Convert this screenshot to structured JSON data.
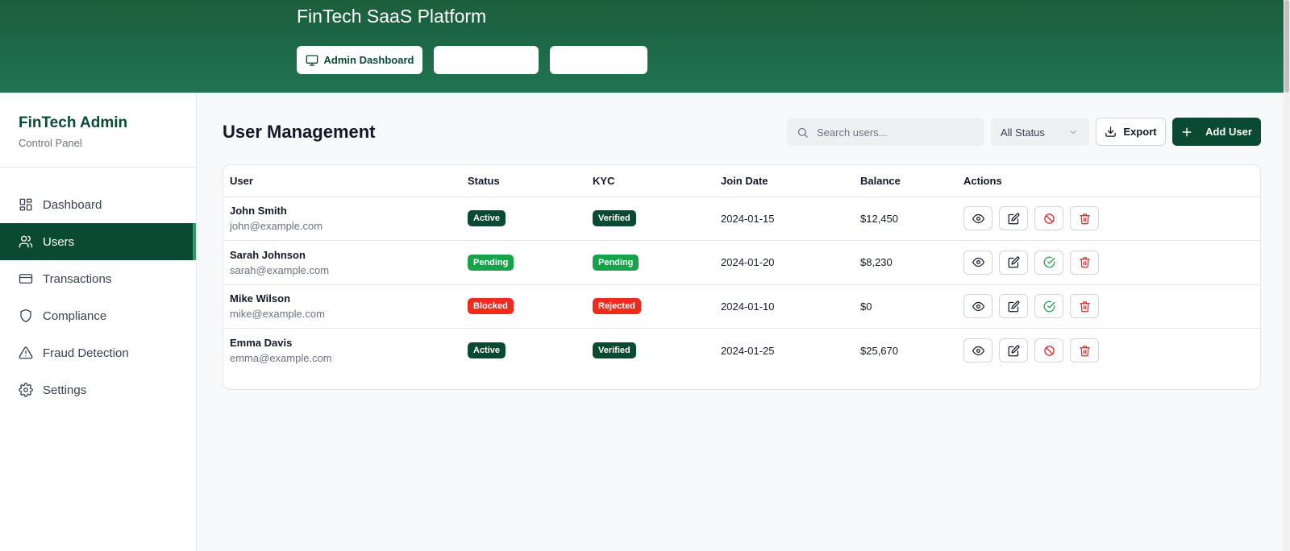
{
  "colors": {
    "brand_dark": "#0b4a32",
    "banner": "#1b5e3b",
    "badge_active": "#0b4a32",
    "badge_pending": "#16a34a",
    "badge_blocked": "#ef2b1e",
    "icon_danger": "#dc2626",
    "icon_success": "#16a34a"
  },
  "banner": {
    "title": "FinTech SaaS Platform",
    "tabs": [
      {
        "label": "Admin Dashboard",
        "icon": "monitor-icon"
      },
      {
        "label": ""
      },
      {
        "label": ""
      }
    ]
  },
  "sidebar": {
    "title": "FinTech Admin",
    "subtitle": "Control Panel",
    "items": [
      {
        "label": "Dashboard",
        "icon": "dashboard-icon",
        "active": false
      },
      {
        "label": "Users",
        "icon": "users-icon",
        "active": true
      },
      {
        "label": "Transactions",
        "icon": "credit-card-icon",
        "active": false
      },
      {
        "label": "Compliance",
        "icon": "shield-icon",
        "active": false
      },
      {
        "label": "Fraud Detection",
        "icon": "warning-icon",
        "active": false
      },
      {
        "label": "Settings",
        "icon": "gear-icon",
        "active": false
      }
    ]
  },
  "main": {
    "title": "User Management",
    "search": {
      "placeholder": "Search users...",
      "value": ""
    },
    "status_filter": {
      "selected": "All Status"
    },
    "export_label": "Export",
    "add_label": "Add User",
    "table": {
      "columns": [
        "User",
        "Status",
        "KYC",
        "Join Date",
        "Balance",
        "Actions"
      ],
      "rows": [
        {
          "name": "John Smith",
          "email": "john@example.com",
          "status": "Active",
          "kyc": "Verified",
          "join_date": "2024-01-15",
          "balance": "$12,450",
          "toggle_action": "block"
        },
        {
          "name": "Sarah Johnson",
          "email": "sarah@example.com",
          "status": "Pending",
          "kyc": "Pending",
          "join_date": "2024-01-20",
          "balance": "$8,230",
          "toggle_action": "approve"
        },
        {
          "name": "Mike Wilson",
          "email": "mike@example.com",
          "status": "Blocked",
          "kyc": "Rejected",
          "join_date": "2024-01-10",
          "balance": "$0",
          "toggle_action": "approve"
        },
        {
          "name": "Emma Davis",
          "email": "emma@example.com",
          "status": "Active",
          "kyc": "Verified",
          "join_date": "2024-01-25",
          "balance": "$25,670",
          "toggle_action": "block"
        }
      ]
    }
  }
}
